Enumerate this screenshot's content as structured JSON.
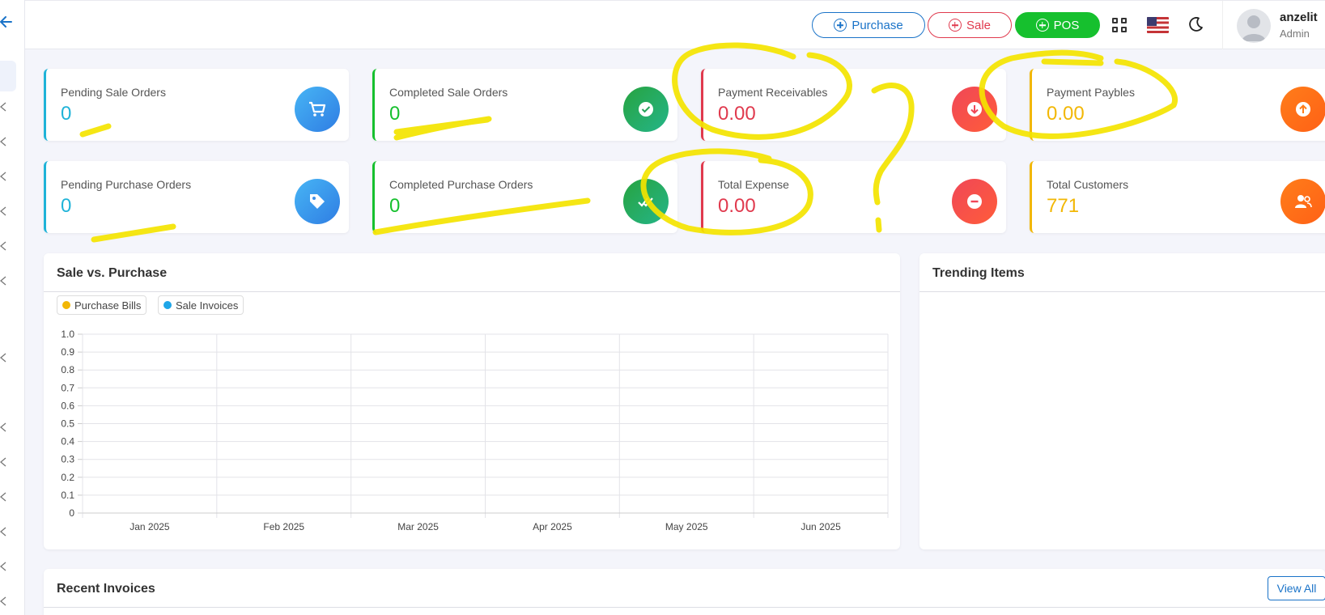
{
  "header": {
    "purchase_label": "Purchase",
    "sale_label": "Sale",
    "pos_label": "POS",
    "user_name": "anzelit",
    "user_role": "Admin"
  },
  "cards": [
    {
      "label": "Pending Sale Orders",
      "value": "0",
      "color": "#1fb3d8",
      "icon": "cart-icon"
    },
    {
      "label": "Completed Sale Orders",
      "value": "0",
      "color": "#16c02e",
      "icon": "check-icon"
    },
    {
      "label": "Payment Receivables",
      "value": "0.00",
      "color": "#e03a4e",
      "icon": "arrow-down-icon"
    },
    {
      "label": "Payment Paybles",
      "value": "0.00",
      "color": "#f2b705",
      "icon": "arrow-up-icon"
    },
    {
      "label": "Pending Purchase Orders",
      "value": "0",
      "color": "#1fb3d8",
      "icon": "tag-icon"
    },
    {
      "label": "Completed Purchase Orders",
      "value": "0",
      "color": "#16c02e",
      "icon": "double-check-icon"
    },
    {
      "label": "Total Expense",
      "value": "0.00",
      "color": "#e03a4e",
      "icon": "minus-icon"
    },
    {
      "label": "Total Customers",
      "value": "771",
      "color": "#f2b705",
      "icon": "users-icon"
    }
  ],
  "sale_vs_purchase": {
    "title": "Sale vs. Purchase",
    "legend": [
      "Purchase Bills",
      "Sale Invoices"
    ]
  },
  "trending": {
    "title": "Trending Items"
  },
  "recent_invoices": {
    "title": "Recent Invoices",
    "view_all_label": "View All"
  },
  "chart_data": {
    "type": "line",
    "title": "",
    "xlabel": "",
    "ylabel": "",
    "categories": [
      "Jan 2025",
      "Feb 2025",
      "Mar 2025",
      "Apr 2025",
      "May 2025",
      "Jun 2025"
    ],
    "series": [
      {
        "name": "Purchase Bills",
        "color": "#f2b705",
        "values": []
      },
      {
        "name": "Sale Invoices",
        "color": "#1fa6e8",
        "values": []
      }
    ],
    "yticks": [
      "0",
      "0.1",
      "0.2",
      "0.3",
      "0.4",
      "0.5",
      "0.6",
      "0.7",
      "0.8",
      "0.9",
      "1.0"
    ],
    "ylim": [
      0,
      1.0
    ],
    "grid": true,
    "legend_position": "top-left"
  }
}
